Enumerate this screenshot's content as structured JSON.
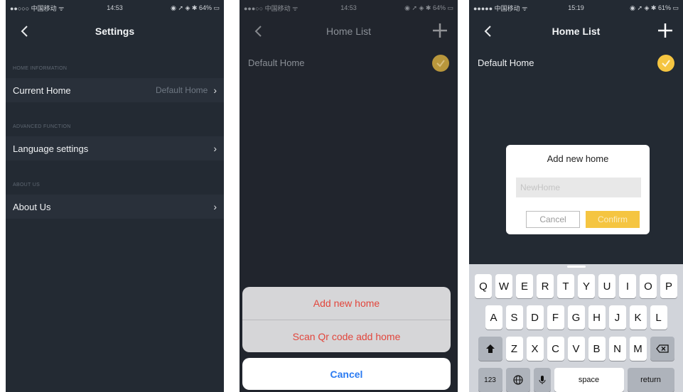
{
  "screen1": {
    "status": {
      "carrier": "●●○○○ 中国移动 ᯤ",
      "time": "14:53",
      "right": "◉ ➚ ◈ ✱ 64% ▭"
    },
    "nav_title": "Settings",
    "sections": [
      {
        "header": "HOME INFORMATION",
        "row_label": "Current Home",
        "row_value": "Default Home"
      },
      {
        "header": "ADVANCED FUNCTION",
        "row_label": "Language settings",
        "row_value": ""
      },
      {
        "header": "ABOUT US",
        "row_label": "About Us",
        "row_value": ""
      }
    ],
    "chevron": "›"
  },
  "screen2": {
    "status": {
      "carrier": "●●●○○ 中国移动 ᯤ",
      "time": "14:53",
      "right": "◉ ➚ ◈ ✱ 64% ▭"
    },
    "nav_title": "Home List",
    "home_name": "Default Home",
    "actions": [
      "Add new home",
      "Scan Qr code add home"
    ],
    "cancel": "Cancel"
  },
  "screen3": {
    "status": {
      "carrier": "●●●●● 中国移动 ᯤ",
      "time": "15:19",
      "right": "◉ ➚ ◈ ✱ 61% ▭"
    },
    "nav_title": "Home List",
    "home_name": "Default Home",
    "dialog": {
      "title": "Add new home",
      "placeholder": "NewHome",
      "cancel": "Cancel",
      "confirm": "Confirm"
    },
    "keyboard": {
      "row1": [
        "Q",
        "W",
        "E",
        "R",
        "T",
        "Y",
        "U",
        "I",
        "O",
        "P"
      ],
      "row2": [
        "A",
        "S",
        "D",
        "F",
        "G",
        "H",
        "J",
        "K",
        "L"
      ],
      "row3": [
        "Z",
        "X",
        "C",
        "V",
        "B",
        "N",
        "M"
      ],
      "numbers": "123",
      "space": "space",
      "return": "return"
    }
  },
  "colors": {
    "accent_yellow": "#f5c541",
    "accent_red": "#e2463c",
    "accent_blue": "#2a7af1",
    "bg_dark": "#232a33"
  },
  "icons": [
    "back-chevron-icon",
    "plus-icon",
    "checkmark-icon",
    "chevron-right-icon",
    "shift-icon",
    "delete-icon",
    "globe-icon",
    "microphone-icon"
  ]
}
